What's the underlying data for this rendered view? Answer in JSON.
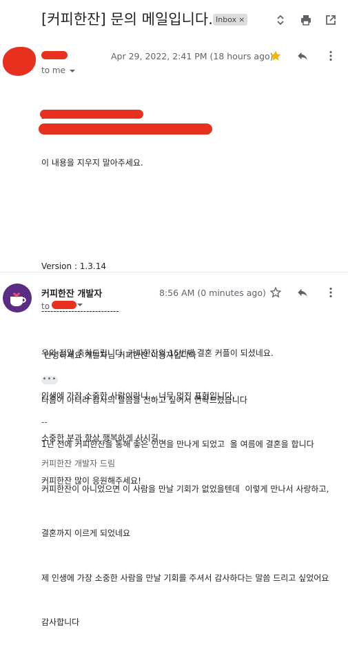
{
  "header": {
    "subject": "[커피한잔] 문의 메일입니다.",
    "label_badge": "Inbox",
    "label_badge_close": "×"
  },
  "message1": {
    "date": "Apr 29, 2022, 2:41 PM (18 hours ago)",
    "to": "to me",
    "body_lines": [
      "--------------------------",
      "이 내용을 지우지 말아주세요.",
      "",
      "",
      "Version : 1.3.14",
      "--------------------------",
      " 안녕하세요 개발자님 커피한잔 이용자입니다",
      "다름이 아니라 감사의 말씀을 전하고 싶어서 연락드렸습니다",
      "1년 전에 커피한잔을 통해 좋은 인연을 만나게 되었고  올 여름에 결혼을 합니다",
      "커피한잔이 아니었으면 이 사람을 만날 기회가 없었을텐데  이렇게 만나서 사랑하고,",
      "결혼까지 이르게 되었네요",
      "제 인생에 가장 소중한 사람을 만날 기회를 주셔서 감사하다는 말씀 드리고 싶었어요",
      "감사합니다"
    ]
  },
  "message2": {
    "sender": "커피한잔 개발자",
    "date": "8:56 AM (0 minutes ago)",
    "to": "to",
    "body_lines": [
      "우와 정말 축하드립니다. 커피한잔의 15번째 결혼 커플이 되셨네요.",
      "인생에 가장 소중한 사람이라니... 너무 멋진 표현입니다.",
      "소중한 분과 항상 행복하게 사시길...",
      "커피한잔 많이 응원해주세요!"
    ],
    "more_dots": "•••",
    "signature": [
      "--",
      "커피한잔 개발자 드림"
    ]
  },
  "colors": {
    "redaction": "#e8301f",
    "star": "#f4b400",
    "avatar_bg": "#5b2c83",
    "heart": "#e84a6b"
  },
  "icons": [
    "chevron-updown-icon",
    "print-icon",
    "open-in-new-icon",
    "star-filled-icon",
    "reply-icon",
    "more-vert-icon",
    "star-outline-icon",
    "coffee-heart-avatar-icon"
  ]
}
